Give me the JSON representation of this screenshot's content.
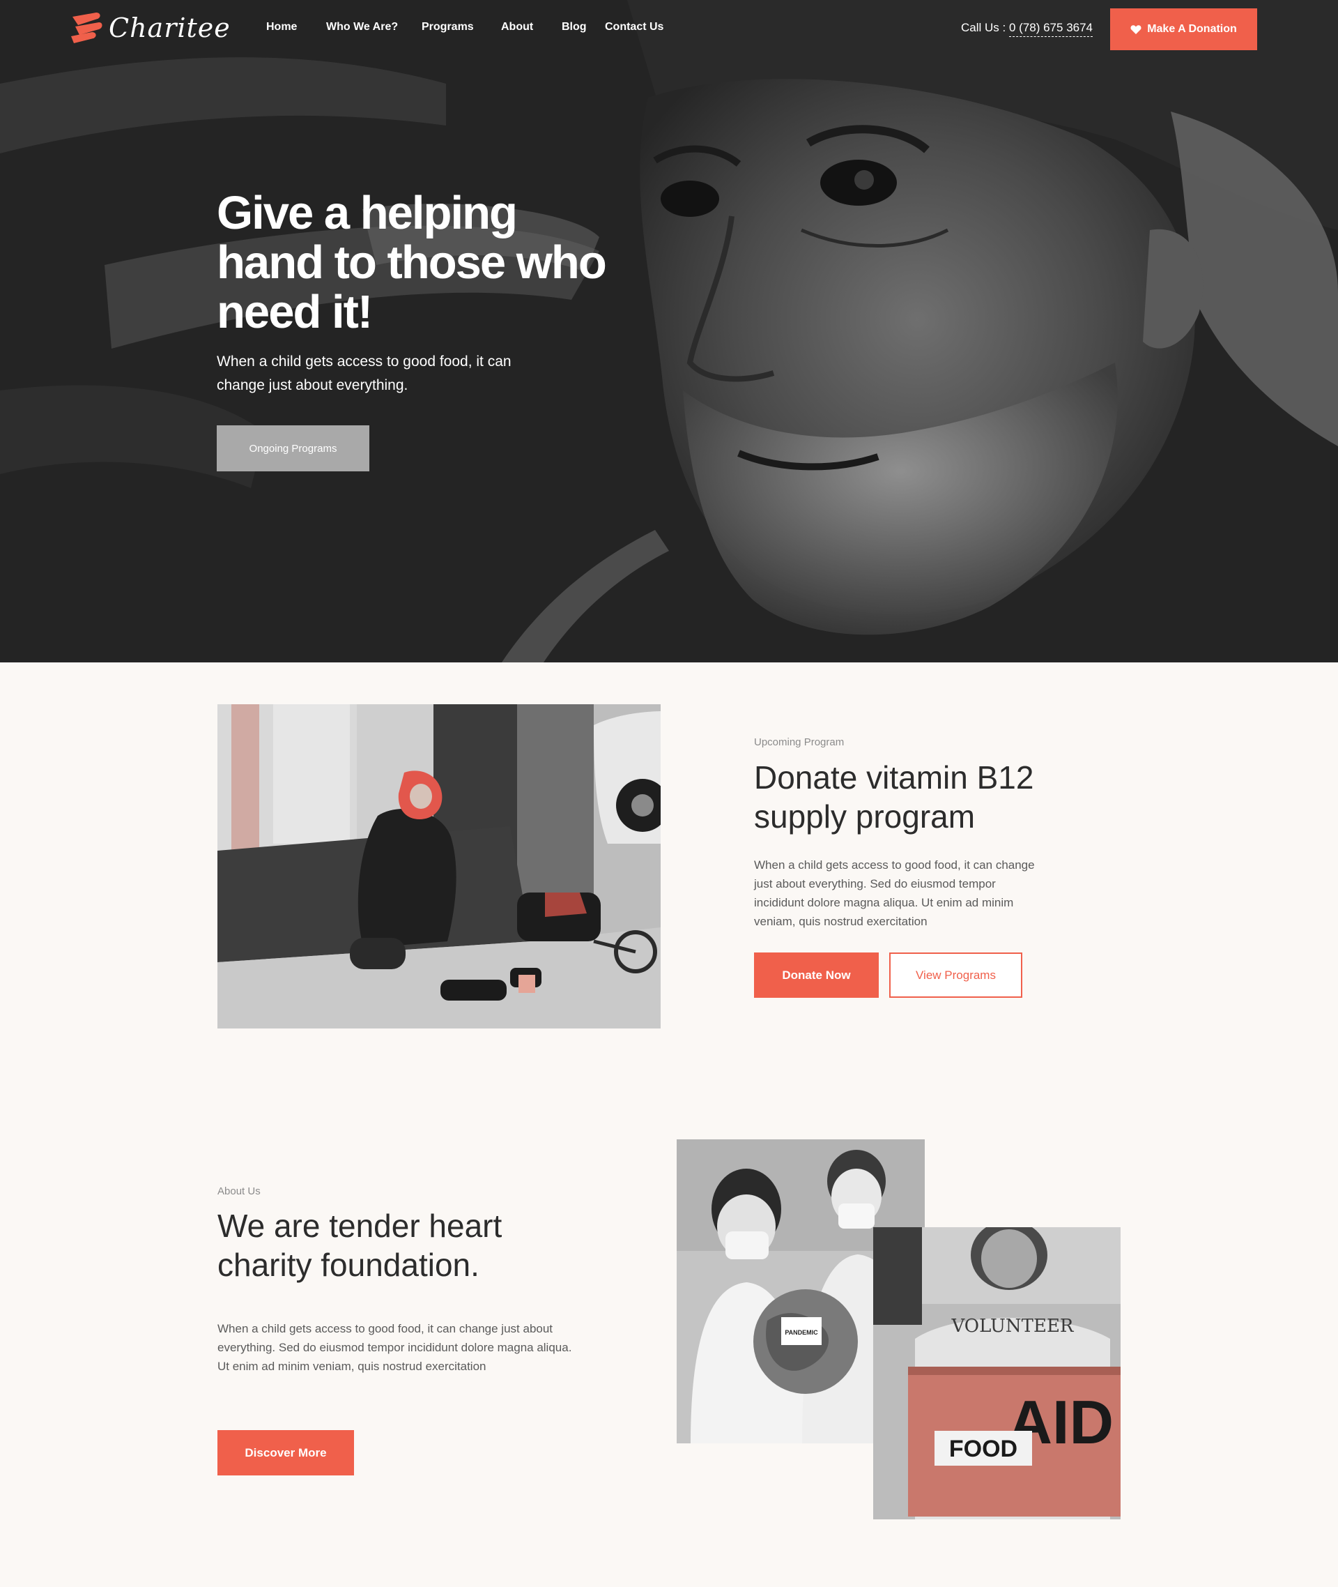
{
  "brand": {
    "name": "Charitee",
    "accent": "#f0604b"
  },
  "nav": {
    "items": [
      "Home",
      "Who We Are?",
      "Programs",
      "About",
      "Blog",
      "Contact Us"
    ],
    "call_label": "Call Us :",
    "call_number": "0 (78) 675 3674",
    "donate_label": "Make A Donation",
    "donate_icon": "heart-icon"
  },
  "hero": {
    "title": "Give a helping hand to those who need it!",
    "subtitle": "When a child gets access to good food, it can change just about everything.",
    "button": "Ongoing Programs"
  },
  "program": {
    "eyebrow": "Upcoming Program",
    "title": "Donate vitamin B12 supply program",
    "body": "When a child gets access to good food, it can change just about everything. Sed do eiusmod tempor incididunt dolore magna aliqua. Ut enim ad minim veniam, quis nostrud exercitation",
    "primary_button": "Donate Now",
    "secondary_button": "View Programs"
  },
  "about": {
    "eyebrow": "About Us",
    "title": "We are tender heart charity foundation.",
    "body": "When a child gets access to good food, it can change just about everything. Sed do eiusmod tempor incididunt dolore magna aliqua. Ut enim ad minim veniam, quis nostrud exercitation",
    "button": "Discover More",
    "photo_texts": {
      "box_label": "PANDEMIC",
      "shirt": "VOLUNTEER",
      "sign_big": "AID",
      "sign_small": "FOOD"
    }
  }
}
